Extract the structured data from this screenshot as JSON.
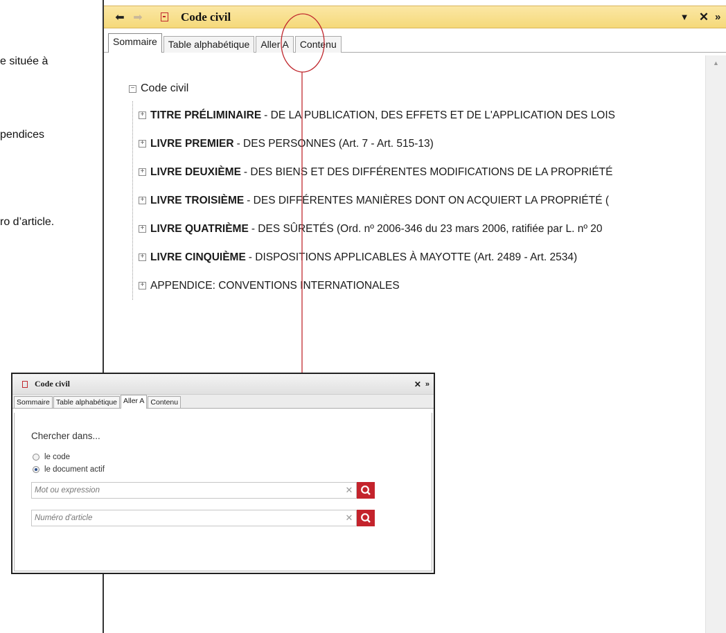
{
  "side_texts": [
    "e située à",
    "pendices",
    "ro d’article."
  ],
  "main_window": {
    "title": "Code civil",
    "tabs": [
      "Sommaire",
      "Table alphabétique",
      "Aller A",
      "Contenu"
    ],
    "tree": {
      "root": "Code civil",
      "items": [
        {
          "bold": "TITRE PRÉLIMINAIRE",
          "text": " - DE LA PUBLICATION, DES EFFETS ET DE L'APPLICATION DES LOIS"
        },
        {
          "bold": "LIVRE PREMIER",
          "text": " - DES PERSONNES (Art. 7 - Art. 515-13)"
        },
        {
          "bold": "LIVRE DEUXIÈME",
          "text": " - DES BIENS ET DES DIFFÉRENTES MODIFICATIONS DE LA PROPRIÉTÉ"
        },
        {
          "bold": "LIVRE TROISIÈME",
          "text": " - DES DIFFÉRENTES MANIÈRES DONT ON ACQUIERT LA PROPRIÉTÉ ("
        },
        {
          "bold": "LIVRE QUATRIÈME",
          "text": " - DES SÛRETÉS (Ord. nº 2006-346 du 23 mars 2006, ratifiée par L. nº 20"
        },
        {
          "bold": "LIVRE CINQUIÈME",
          "text": " - DISPOSITIONS APPLICABLES À MAYOTTE (Art. 2489 - Art. 2534)"
        },
        {
          "bold": "",
          "text": "APPENDICE: CONVENTIONS INTERNATIONALES"
        }
      ]
    }
  },
  "inset_window": {
    "title": "Code civil",
    "tabs": [
      "Sommaire",
      "Table alphabétique",
      "Aller A",
      "Contenu"
    ],
    "search_label": "Chercher dans...",
    "radios": [
      {
        "label": "le code",
        "checked": false
      },
      {
        "label": "le document actif",
        "checked": true
      }
    ],
    "word_placeholder": "Mot ou expression",
    "article_placeholder": "Numéro d'article"
  },
  "colors": {
    "titlebar": "#f5d97a",
    "annotation": "#c0282e",
    "search_button": "#c4232c"
  }
}
